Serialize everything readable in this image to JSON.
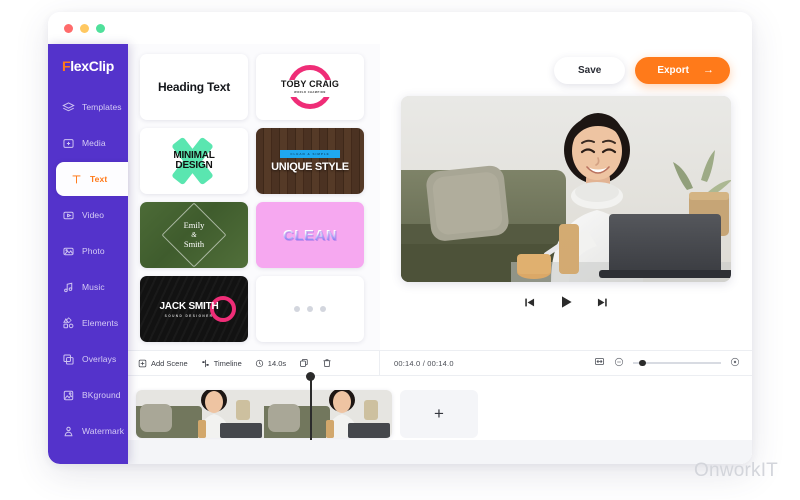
{
  "window": {
    "dots": [
      "close",
      "minimize",
      "maximize"
    ]
  },
  "sidebar": {
    "logo": {
      "accent": "F",
      "rest": "lexClip",
      "accent_color": "#ff7a1a"
    },
    "items": [
      {
        "label": "Templates",
        "icon": "layers-icon",
        "active": false
      },
      {
        "label": "Media",
        "icon": "media-folder-icon",
        "active": false
      },
      {
        "label": "Text",
        "icon": "text-icon",
        "active": true
      },
      {
        "label": "Video",
        "icon": "video-icon",
        "active": false
      },
      {
        "label": "Photo",
        "icon": "photo-icon",
        "active": false
      },
      {
        "label": "Music",
        "icon": "music-note-icon",
        "active": false
      },
      {
        "label": "Elements",
        "icon": "shapes-icon",
        "active": false
      },
      {
        "label": "Overlays",
        "icon": "overlays-icon",
        "active": false
      },
      {
        "label": "BKground",
        "icon": "background-icon",
        "active": false
      },
      {
        "label": "Watermark",
        "icon": "watermark-icon",
        "active": false
      }
    ],
    "background_color": "#5433cb"
  },
  "templates": [
    {
      "id": "heading-text",
      "title": "Heading Text"
    },
    {
      "id": "toby-craig",
      "title": "TOBY CRAIG",
      "subtitle": "WORLD CHAMPION"
    },
    {
      "id": "minimal-design",
      "line1": "MINIMAL",
      "line2": "DESIGN"
    },
    {
      "id": "unique-style",
      "badge": "CLEAN & SIMPLE",
      "title": "UNIQUE STYLE"
    },
    {
      "id": "emily-smith",
      "line1": "Emily",
      "amp": "&",
      "line2": "Smith"
    },
    {
      "id": "clean",
      "title": "CLEAN"
    },
    {
      "id": "jack-smith",
      "title": "JACK SMITH",
      "subtitle": "SOUND DESIGNER"
    },
    {
      "id": "more-templates",
      "dots": "•••"
    }
  ],
  "header": {
    "save_label": "Save",
    "export_label": "Export",
    "export_arrow": "→",
    "export_color": "#ff7a1a"
  },
  "player": {
    "prev_label": "Previous frame",
    "play_label": "Play",
    "next_label": "Next frame"
  },
  "toolbar": {
    "add_scene_label": "Add Scene",
    "timeline_label": "Timeline",
    "duration_label": "14.0s",
    "duplicate_label": "Duplicate",
    "delete_label": "Delete",
    "timecode": "00:14.0 / 00:14.0",
    "fit_label": "Fit to screen",
    "zoom_out_label": "−",
    "zoom_in_label": "+"
  },
  "timeline": {
    "clips": [
      "scene-1-frame-a",
      "scene-1-frame-b"
    ],
    "add_clip_label": "+"
  },
  "watermark": {
    "text": "OnworkIT"
  }
}
